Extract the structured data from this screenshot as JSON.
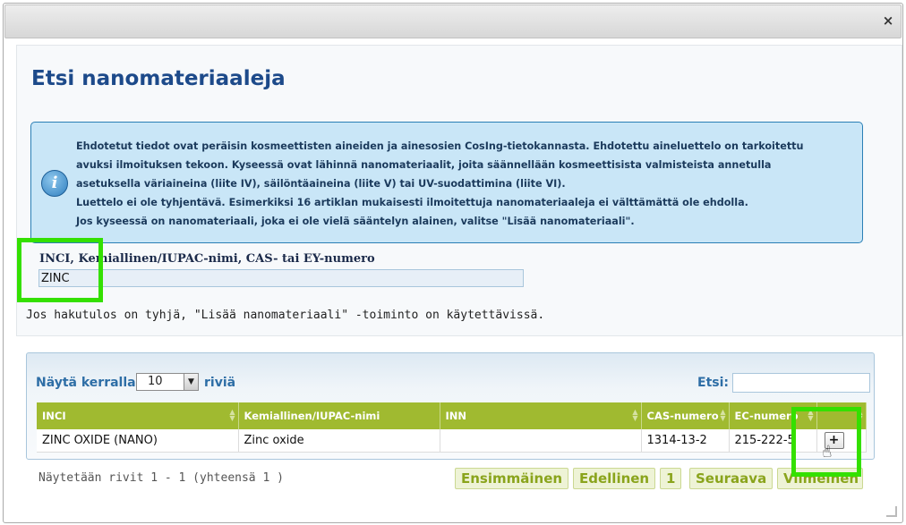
{
  "dialog": {
    "close_label": "×"
  },
  "page_title": "Etsi nanomateriaaleja",
  "info": {
    "lines": [
      "Ehdotetut tiedot ovat peräisin kosmeettisten aineiden ja ainesosien CosIng-tietokannasta. Ehdotettu aineluettelo on tarkoitettu",
      "avuksi ilmoituksen tekoon. Kyseessä ovat lähinnä nanomateriaalit, joita säännellään kosmeettisista valmisteista annetulla",
      "asetuksella väriaineina (liite IV), säilöntäaineina (liite V) tai UV-suodattimina (liite VI).",
      "Luettelo ei ole tyhjentävä. Esimerkiksi 16 artiklan mukaisesti ilmoitettuja nanomateriaaleja ei välttämättä ole ehdolla.",
      "Jos kyseessä on nanomateriaali, joka ei ole vielä sääntelyn alainen, valitse \"Lisää nanomateriaali\"."
    ]
  },
  "search": {
    "label": "INCI, Kemiallinen/IUPAC-nimi, CAS- tai EY-numero",
    "value": "ZINC"
  },
  "hint": "Jos hakutulos on tyhjä, \"Lisää nanomateriaali\" -toiminto on käytettävissä.",
  "table": {
    "show_label": "Näytä kerralla",
    "page_size": "10",
    "rows_label": "riviä",
    "filter_label": "Etsi:",
    "filter_value": "",
    "columns": [
      "INCI",
      "Kemiallinen/IUPAC-nimi",
      "INN",
      "CAS-numero",
      "EC-numero",
      ""
    ],
    "rows": [
      {
        "inci": "ZINC OXIDE (NANO)",
        "chemical": "Zinc oxide",
        "inn": "",
        "cas": "1314-13-2",
        "ec": "215-222-5",
        "action": "+"
      }
    ],
    "info": "Näytetään rivit 1 - 1 (yhteensä 1 )"
  },
  "pagination": {
    "first": "Ensimmäinen",
    "previous": "Edellinen",
    "page": "1",
    "next": "Seuraava",
    "last": "Viimeinen"
  },
  "colors": {
    "title": "#1d4a8a",
    "info_bg": "#c9e6f7",
    "table_header": "#a0ba30",
    "highlight": "#34e000"
  }
}
